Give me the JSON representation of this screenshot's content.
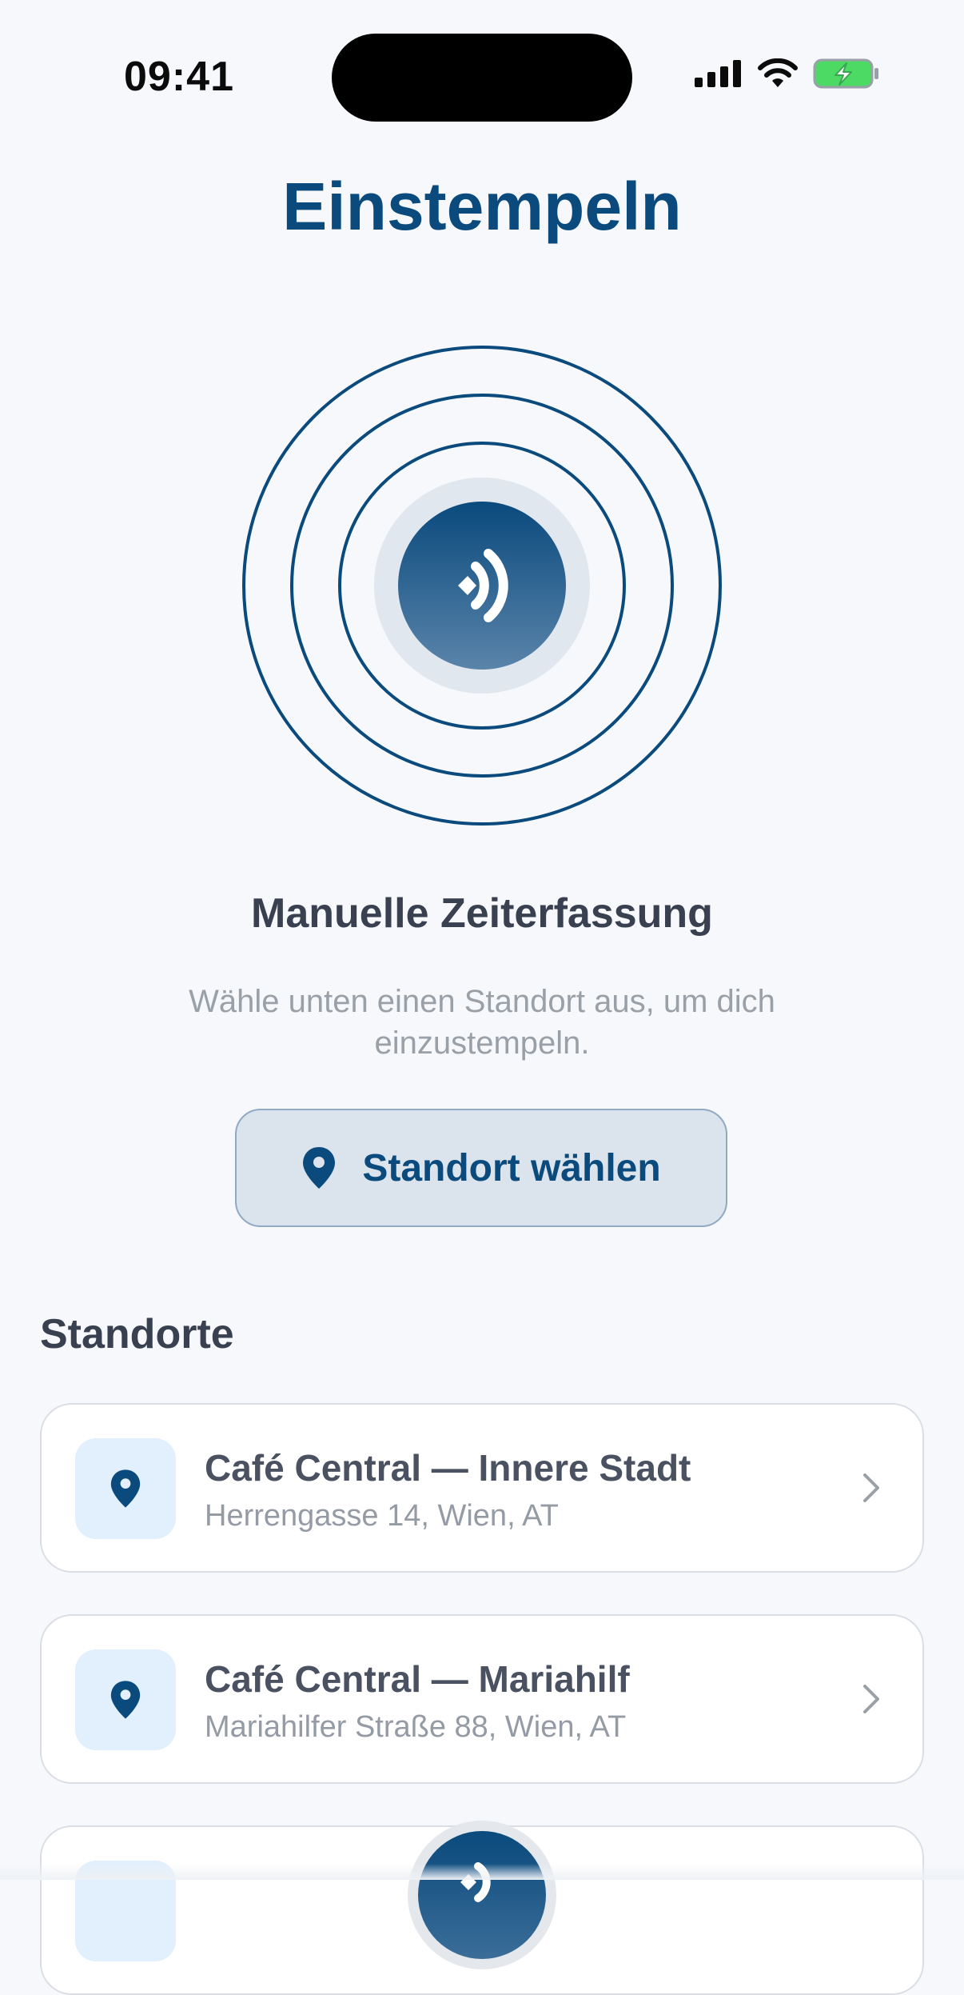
{
  "status_bar": {
    "time": "09:41",
    "icons": [
      "cellular-signal-icon",
      "wifi-icon",
      "battery-charging-icon"
    ]
  },
  "header": {
    "title": "Einstempeln"
  },
  "hero": {
    "icon": "nfc-tap-icon",
    "heading": "Manuelle Zeiterfassung",
    "subtitle": "Wähle unten einen Standort aus, um dich einzustempeln."
  },
  "choose_button": {
    "icon": "map-pin-icon",
    "label": "Standort wählen"
  },
  "locations": {
    "title": "Standorte",
    "items": [
      {
        "name": "Café Central — Innere Stadt",
        "address": "Herrengasse 14, Wien, AT"
      },
      {
        "name": "Café Central — Mariahilf",
        "address": "Mariahilfer Straße 88, Wien, AT"
      }
    ]
  },
  "colors": {
    "brand": "#0a4a7d",
    "background": "#f6f8fb",
    "battery_green": "#4cd964"
  }
}
